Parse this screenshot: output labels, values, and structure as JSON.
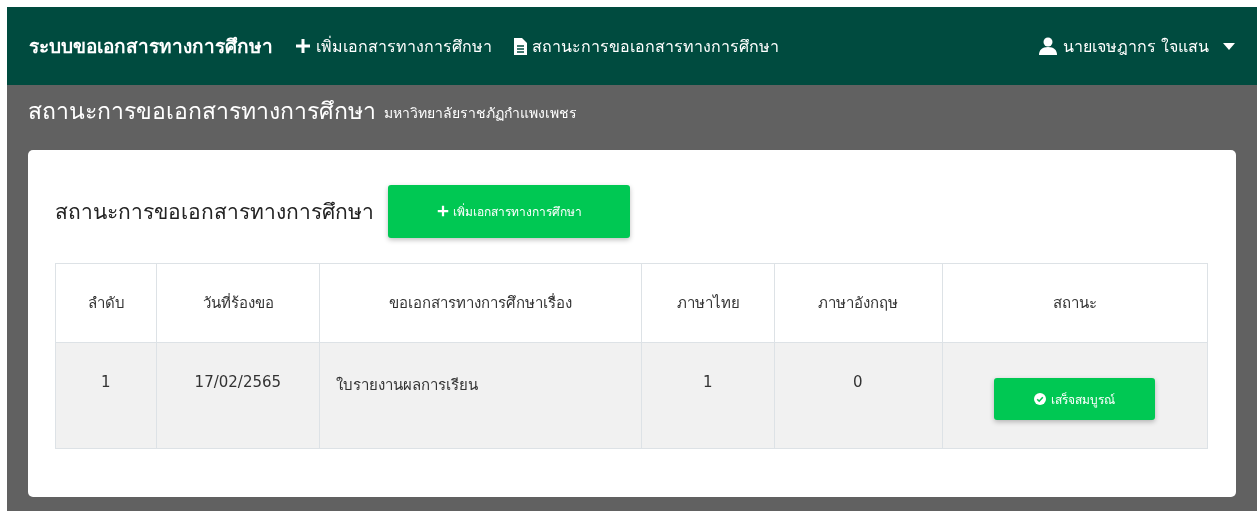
{
  "navbar": {
    "brand": "ระบบขอเอกสารทางการศึกษา",
    "links": [
      {
        "label": "เพิ่มเอกสารทางการศึกษา",
        "kind": "add"
      },
      {
        "label": "สถานะการขอเอกสารทางการศึกษา",
        "kind": "status"
      }
    ],
    "user": {
      "name": "นายเจษฎากร ใจแสน"
    }
  },
  "page_header": {
    "title": "สถานะการขอเอกสารทางการศึกษา",
    "subtitle": "มหาวิทยาลัยราชภัฏกำแพงเพชร"
  },
  "card": {
    "title": "สถานะการขอเอกสารทางการศึกษา",
    "add_button": "เพิ่มเอกสารทางการศึกษา",
    "table": {
      "columns": [
        "ลำดับ",
        "วันที่ร้องขอ",
        "ขอเอกสารทางการศึกษาเรื่อง",
        "ภาษาไทย",
        "ภาษาอังกฤษ",
        "สถานะ"
      ],
      "rows": [
        {
          "number": "1",
          "date": "17/02/2565",
          "document": "ใบรายงานผลการเรียน",
          "thai": "1",
          "english": "0",
          "status": {
            "label": "เสร็จสมบูรณ์",
            "kind": "done"
          }
        }
      ]
    }
  }
}
